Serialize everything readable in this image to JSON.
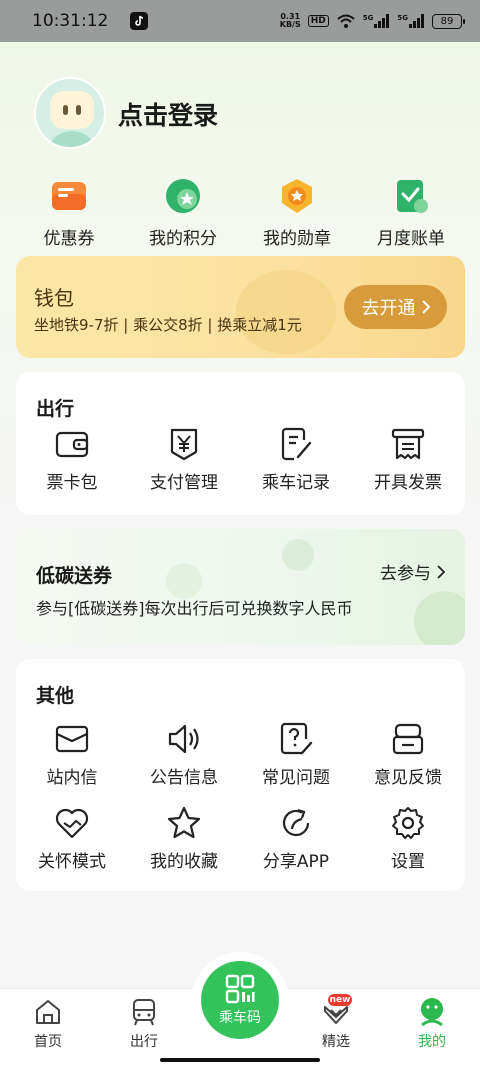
{
  "status_bar": {
    "time": "10:31:12",
    "net_speed_value": "0.31",
    "net_speed_unit": "KB/S",
    "hd": "HD",
    "signal1": "5G",
    "signal2": "5G",
    "battery": "89"
  },
  "profile": {
    "login_text": "点击登录"
  },
  "quick_links": [
    {
      "label": "优惠券",
      "icon": "coupon-icon"
    },
    {
      "label": "我的积分",
      "icon": "points-icon"
    },
    {
      "label": "我的勋章",
      "icon": "medal-icon"
    },
    {
      "label": "月度账单",
      "icon": "bill-icon"
    }
  ],
  "wallet": {
    "title": "钱包",
    "subtitle": "坐地铁9-7折 | 乘公交8折 | 换乘立减1元",
    "button": "去开通"
  },
  "travel": {
    "title": "出行",
    "items": [
      {
        "label": "票卡包",
        "icon": "wallet-icon"
      },
      {
        "label": "支付管理",
        "icon": "yen-icon"
      },
      {
        "label": "乘车记录",
        "icon": "record-icon"
      },
      {
        "label": "开具发票",
        "icon": "invoice-icon"
      }
    ]
  },
  "low_carbon": {
    "title": "低碳送券",
    "action": "去参与",
    "subtitle": "参与[低碳送券]每次出行后可兑换数字人民币"
  },
  "other": {
    "title": "其他",
    "row1": [
      {
        "label": "站内信",
        "icon": "mail-icon"
      },
      {
        "label": "公告信息",
        "icon": "speaker-icon"
      },
      {
        "label": "常见问题",
        "icon": "question-icon"
      },
      {
        "label": "意见反馈",
        "icon": "feedback-icon"
      }
    ],
    "row2": [
      {
        "label": "关怀模式",
        "icon": "care-icon"
      },
      {
        "label": "我的收藏",
        "icon": "star-icon"
      },
      {
        "label": "分享APP",
        "icon": "share-icon"
      },
      {
        "label": "设置",
        "icon": "gear-icon"
      }
    ]
  },
  "bottom_nav": {
    "home": "首页",
    "travel": "出行",
    "qr": "乘车码",
    "featured": "精选",
    "featured_badge": "new",
    "mine": "我的"
  },
  "colors": {
    "accent_green": "#33c35a",
    "wallet_button": "#d89b3c"
  }
}
